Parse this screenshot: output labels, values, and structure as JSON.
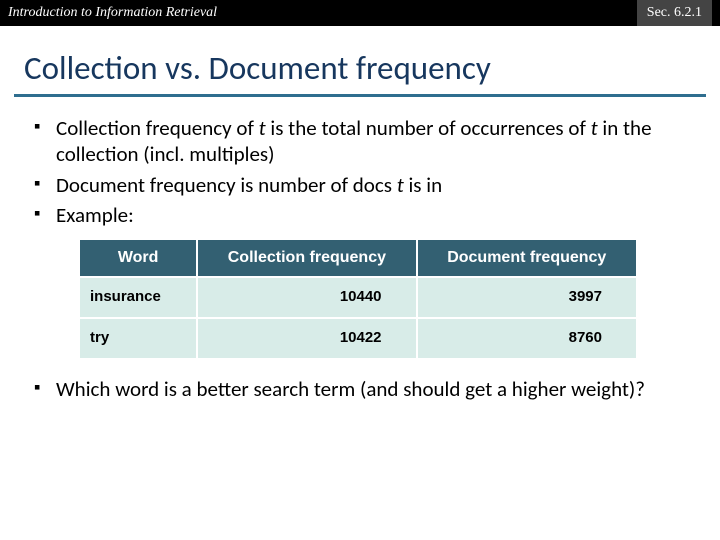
{
  "topbar": {
    "left": "Introduction to Information Retrieval",
    "right": "Sec. 6.2.1"
  },
  "title": "Collection vs. Document frequency",
  "bullets": {
    "b1a": "Collection frequency of ",
    "b1b": "t",
    "b1c": " is the total number of occurrences of ",
    "b1d": "t",
    "b1e": " in the collection (incl. multiples)",
    "b2a": "Document frequency is number of docs ",
    "b2b": "t",
    "b2c": " is in",
    "b3": "Example:"
  },
  "table": {
    "headers": {
      "h1": "Word",
      "h2": "Collection frequency",
      "h3": "Document frequency"
    },
    "rows": [
      {
        "word": "insurance",
        "cf": "10440",
        "df": "3997"
      },
      {
        "word": "try",
        "cf": "10422",
        "df": "8760"
      }
    ]
  },
  "closing": "Which word is a better search term (and should get a higher weight)?",
  "chart_data": {
    "type": "table",
    "columns": [
      "Word",
      "Collection frequency",
      "Document frequency"
    ],
    "rows": [
      [
        "insurance",
        10440,
        3997
      ],
      [
        "try",
        10422,
        8760
      ]
    ]
  }
}
